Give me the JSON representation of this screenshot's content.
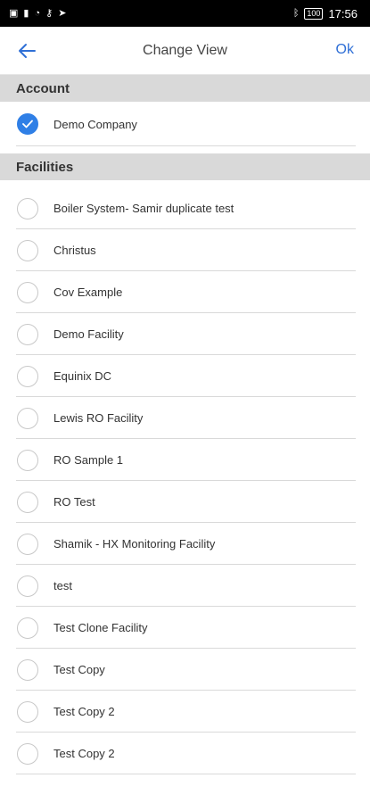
{
  "status_bar": {
    "left_icons": [
      "notification-icon",
      "signal-icon",
      "wifi-icon",
      "key-icon",
      "location-icon"
    ],
    "right_icons": [
      "bluetooth-icon"
    ],
    "battery": "100",
    "time": "17:56"
  },
  "header": {
    "title": "Change View",
    "ok_label": "Ok"
  },
  "account": {
    "section_title": "Account",
    "item": {
      "label": "Demo Company",
      "selected": true
    }
  },
  "facilities": {
    "section_title": "Facilities",
    "items": [
      {
        "label": "Boiler System- Samir duplicate test"
      },
      {
        "label": "Christus"
      },
      {
        "label": "Cov Example"
      },
      {
        "label": "Demo Facility"
      },
      {
        "label": "Equinix DC"
      },
      {
        "label": "Lewis RO Facility"
      },
      {
        "label": "RO Sample 1"
      },
      {
        "label": "RO Test"
      },
      {
        "label": "Shamik - HX Monitoring Facility"
      },
      {
        "label": "test"
      },
      {
        "label": "Test Clone Facility"
      },
      {
        "label": "Test Copy"
      },
      {
        "label": "Test Copy 2"
      },
      {
        "label": "Test Copy 2"
      }
    ]
  },
  "colors": {
    "accent": "#2f6fd6",
    "section_bg": "#d9d9d9"
  }
}
